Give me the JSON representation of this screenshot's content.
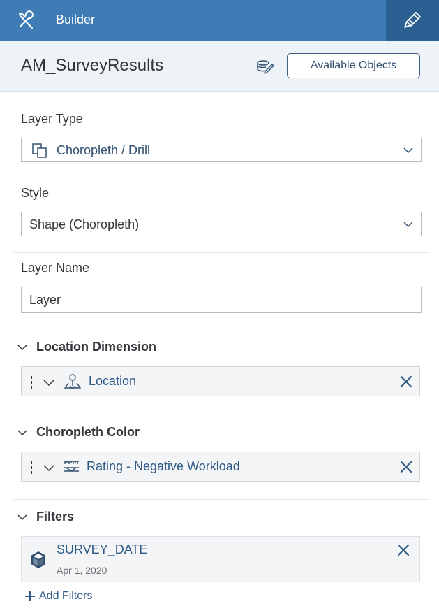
{
  "header": {
    "title": "Builder",
    "background": "#3f7bb5",
    "active_tab_background": "#2c5f92",
    "icons": {
      "left": "wrench-screwdriver-icon",
      "right": "paint-brush-icon"
    }
  },
  "model": {
    "name": "AM_SurveyResults",
    "edit_icon": "edit-model-icon",
    "available_objects_label": "Available Objects"
  },
  "layer_type": {
    "label": "Layer Type",
    "value": "Choropleth / Drill",
    "icon": "choropleth-drill-icon"
  },
  "style": {
    "label": "Style",
    "value": "Shape (Choropleth)"
  },
  "layer_name": {
    "label": "Layer Name",
    "value": "Layer"
  },
  "location_dimension": {
    "title": "Location Dimension",
    "token_label": "Location",
    "token_icon": "location-pin-icon"
  },
  "choropleth_color": {
    "title": "Choropleth Color",
    "token_label": "Rating - Negative Workload",
    "token_icon": "measure-ruler-icon"
  },
  "filters": {
    "title": "Filters",
    "items": [
      {
        "name": "SURVEY_DATE",
        "value": "Apr 1, 2020",
        "icon": "dimension-cube-icon"
      }
    ],
    "add_label": "Add Filters"
  },
  "colors": {
    "link": "#2f5a87",
    "close": "#2f5a87",
    "text": "#32363a"
  }
}
